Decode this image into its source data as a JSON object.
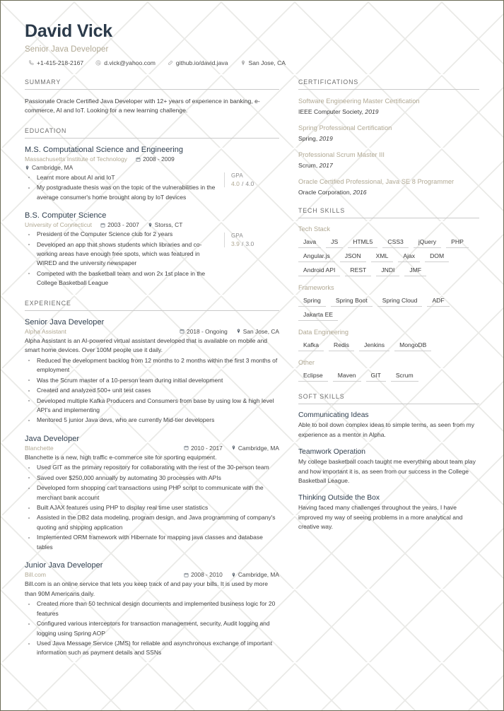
{
  "header": {
    "name": "David Vick",
    "job_title": "Senior Java Developer",
    "contacts": [
      {
        "icon": "phone-icon",
        "text": "+1-415-218-2167"
      },
      {
        "icon": "email-icon",
        "text": "d.vick@yahoo.com"
      },
      {
        "icon": "link-icon",
        "text": "github.io/david.java"
      },
      {
        "icon": "location-pin-icon",
        "text": "San Jose, CA"
      }
    ]
  },
  "summary": {
    "title": "SUMMARY",
    "text": "Passionate Oracle Certified Java Developer with 12+ years of experience in banking, e-commerce, AI and IoT. Looking for a new learning challenge."
  },
  "education": {
    "title": "EDUCATION",
    "entries": [
      {
        "degree": "M.S. Computational Science and Engineering",
        "school": "Massachusetts Institute of Technology",
        "dates": "2008 - 2009",
        "location": "Cambridge, MA",
        "gpa_label": "GPA",
        "gpa": "4.0",
        "gpa_max": "4.0",
        "bullets": [
          "Learnt more about AI and IoT",
          "My postgraduate thesis was on the topic of the vulnerabilities in the average consumer's home brought along by IoT devices"
        ]
      },
      {
        "degree": "B.S. Computer Science",
        "school": "University of Connecticut",
        "dates": "2003 - 2007",
        "location": "Storss, CT",
        "gpa_label": "GPA",
        "gpa": "3.9",
        "gpa_max": "3.0",
        "bullets": [
          "President of the Computer Science club for 2 years",
          "Developed an app that shows students which libraries and co-working areas have enough free spots, which was featured in WIRED and the university newspaper",
          "Competed with the basketball team and won 2x 1st place in the College Basketball League"
        ]
      }
    ]
  },
  "experience": {
    "title": "EXPERIENCE",
    "entries": [
      {
        "role": "Senior Java Developer",
        "company": "Alpha Assistant",
        "dates": "2018 - Ongoing",
        "location": "San Jose, CA",
        "description": "Alpha Assistant is an AI-powered virtual assistant developed that is available on mobile and smart home devices. Over 100M people use it daily.",
        "bullets": [
          "Reduced the development backlog from 12 months to 2 months within the first 3 months of employment",
          "Was the Scrum master of a 10-person team during initial development",
          "Created and analyzed 500+ unit test cases",
          "Developed multiple Kafka Producers and Consumers from base by using low & high level API's and implementing",
          "Mentored 5 junior Java devs, who are currently Mid-tier developers"
        ]
      },
      {
        "role": "Java Developer",
        "company": "Blanchette",
        "dates": "2010 - 2017",
        "location": "Cambridge, MA",
        "description": "Blanchette is a new, high traffic e-commerce site for sporting equipment.",
        "bullets": [
          "Used GIT as the primary repository for collaborating with the rest of the 30-person team",
          "Saved over $250,000 annually by automating 30 processes with APIs",
          "Developed form shopping cart transactions using PHP script to communicate with the merchant bank account",
          "Built AJAX features using PHP to display real time user statistics",
          "Assisted in the DB2 data modeling, program design, and Java programming of company's quoting and shipping application",
          "Implemented ORM  framework with Hibernate for mapping java classes and database tables"
        ]
      },
      {
        "role": "Junior Java Developer",
        "company": "Bill.com",
        "dates": "2008 - 2010",
        "location": "Cambridge, MA",
        "description": "Bill.com is an online service that lets you keep track of and pay your bills. It is used by more than 90M Americans daily.",
        "bullets": [
          "Created more than 50 technical design documents and implemented business logic for 20 features",
          "Configured various interceptors for transaction management, security, Audit logging and logging using Spring AOP",
          "Used Java Message Service (JMS) for reliable and asynchronous exchange of important information such as payment details and SSNs"
        ]
      }
    ]
  },
  "certifications": {
    "title": "CERTIFICATIONS",
    "entries": [
      {
        "name": "Software Engineering Master Certification",
        "issuer": "IEEE Computer Society,",
        "year": "2019"
      },
      {
        "name": "Spring Professional Certification",
        "issuer": "Spring,",
        "year": "2019"
      },
      {
        "name": "Professional Scrum Master III",
        "issuer": "Scrum,",
        "year": "2017"
      },
      {
        "name": "Oracle Certified Professional, Java SE 8 Programmer",
        "issuer": "Oracle Corporation,",
        "year": "2016"
      }
    ]
  },
  "tech_skills": {
    "title": "TECH SKILLS",
    "groups": [
      {
        "name": "Tech Stack",
        "tags": [
          "Java",
          "JS",
          "HTML5",
          "CSS3",
          "jQuery",
          "PHP",
          "Angular.js",
          "JSON",
          "XML",
          "Ajax",
          "DOM",
          "Android API",
          "REST",
          "JNDI",
          "JMF"
        ]
      },
      {
        "name": "Frameworks",
        "tags": [
          "Spring",
          "Spring Boot",
          "Spring Cloud",
          "ADF",
          "Jakarta EE"
        ]
      },
      {
        "name": "Data Engineering",
        "tags": [
          "Kafka",
          "Redis",
          "Jenkins",
          "MongoDB"
        ]
      },
      {
        "name": "Other",
        "tags": [
          "Eclipse",
          "Maven",
          "GIT",
          "Scrum"
        ]
      }
    ]
  },
  "soft_skills": {
    "title": "SOFT SKILLS",
    "entries": [
      {
        "name": "Communicating Ideas",
        "description": "Able to boil down complex ideas to simple terms, as seen from my experience as a mentor in Alpha."
      },
      {
        "name": "Teamwork Operation",
        "description": "My college basketball coach taught me everything about team play and how important it is, as seen from our success in the College Basketball League."
      },
      {
        "name": "Thinking Outside the Box",
        "description": "Having faced many challenges throughout the years, I have improved my way of seeing problems in a more analytical and creative way."
      }
    ]
  },
  "colors": {
    "name_navy": "#2b3a4a",
    "accent_tan": "#b0a893",
    "body_text": "#3f3f3f",
    "rule_gray": "#c9c9c9",
    "page_border": "#6b6b55"
  }
}
